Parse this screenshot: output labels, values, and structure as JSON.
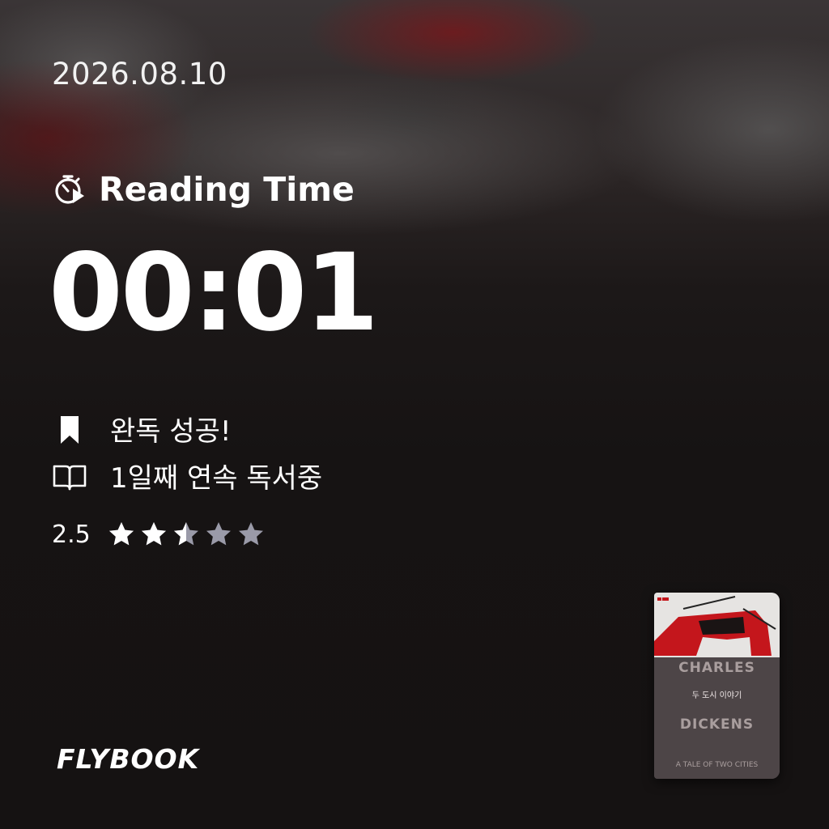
{
  "date": "2026.08.10",
  "reading_time": {
    "icon": "stopwatch-play-icon",
    "label": "Reading Time",
    "value": "00:01"
  },
  "stats": [
    {
      "icon": "bookmark-icon",
      "text": "완독 성공!"
    },
    {
      "icon": "open-book-icon",
      "text": "1일째 연속 독서중"
    }
  ],
  "rating": {
    "value": "2.5",
    "max": 5,
    "filled": 2.5,
    "color_filled": "#ffffff",
    "color_empty": "#9a9aa8"
  },
  "brand": {
    "logo": "FLYBOOK"
  },
  "book": {
    "korean_title": "두 도시 이야기",
    "cover_lines": [
      "CHARLES",
      "DICKENS",
      "A TALE OF TWO CITIES"
    ],
    "accent": "#c4161c"
  }
}
